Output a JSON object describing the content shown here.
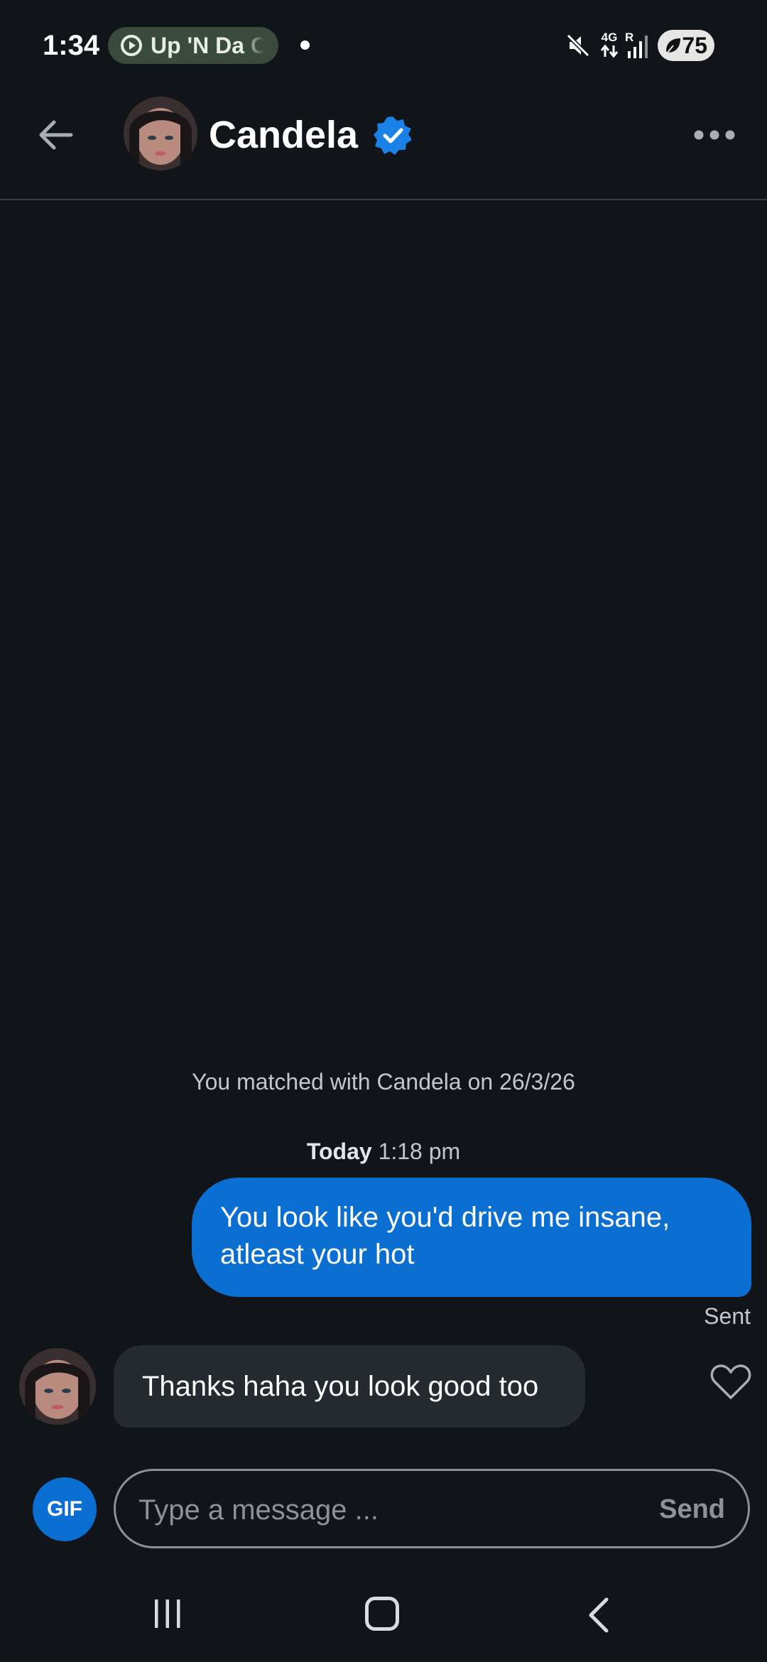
{
  "status_bar": {
    "time": "1:34",
    "media_pill_text": "Up 'N Da C",
    "network": "4G",
    "roaming": "R",
    "battery_level": "75",
    "icons": [
      "mute-icon",
      "data-arrows-icon",
      "signal-icon",
      "battery-saver-icon"
    ]
  },
  "header": {
    "contact_name": "Candela",
    "verified": true,
    "back_icon": "back-arrow-icon",
    "menu_icon": "more-options-icon"
  },
  "chat": {
    "match_note": "You matched with Candela on 26/3/26",
    "timestamp_day": "Today",
    "timestamp_time": "1:18 pm",
    "messages": [
      {
        "direction": "outgoing",
        "lines": [
          "You look like you'd drive me insane,",
          "atleast your hot"
        ],
        "status": "Sent"
      },
      {
        "direction": "incoming",
        "text": "Thanks haha you look good too",
        "liked": false
      }
    ]
  },
  "composer": {
    "gif_label": "GIF",
    "placeholder": "Type a message ...",
    "send_label": "Send"
  },
  "nav_bar": {
    "icons": [
      "recents-icon",
      "home-icon",
      "back-icon"
    ]
  },
  "colors": {
    "background": "#111419",
    "accent": "#0a6fd1",
    "incoming_bubble": "#252a31",
    "muted_text": "#c3c7cd"
  }
}
